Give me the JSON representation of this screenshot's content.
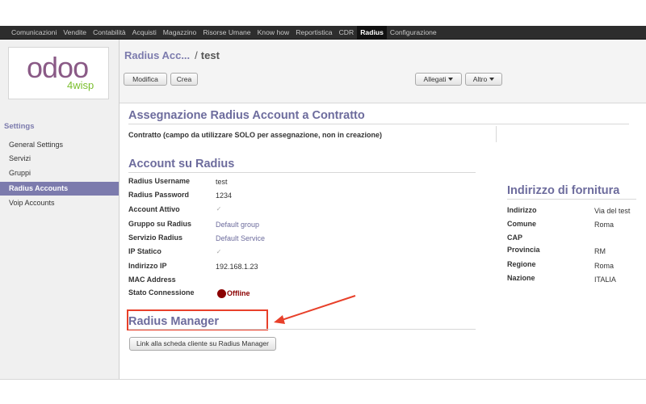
{
  "topmenu": [
    "Comunicazioni",
    "Vendite",
    "Contabilità",
    "Acquisti",
    "Magazzino",
    "Risorse Umane",
    "Know how",
    "Reportistica",
    "CDR",
    "Radius",
    "Configurazione"
  ],
  "topmenu_active": "Radius",
  "logo": {
    "brand": "odoo",
    "sub": "4wisp"
  },
  "sidebar": {
    "heading": "Settings",
    "items": [
      "General Settings",
      "Servizi",
      "Gruppi",
      "Radius Accounts",
      "Voip Accounts"
    ],
    "active": "Radius Accounts"
  },
  "header": {
    "breadcrumb_parent": "Radius Acc...",
    "breadcrumb_sep": "/",
    "breadcrumb_current": "test",
    "edit_label": "Modifica",
    "create_label": "Crea",
    "attachments_label": "Allegati",
    "more_label": "Altro"
  },
  "assignment": {
    "title": "Assegnazione Radius Account a Contratto",
    "contract_label": "Contratto (campo da utilizzare SOLO per assegnazione, non in creazione)"
  },
  "account": {
    "title": "Account su Radius",
    "username_label": "Radius Username",
    "username": "test",
    "password_label": "Radius Password",
    "password": "1234",
    "active_label": "Account Attivo",
    "active": true,
    "group_label": "Gruppo su Radius",
    "group": "Default group",
    "service_label": "Servizio Radius",
    "service": "Default Service",
    "static_ip_label": "IP Statico",
    "static_ip": true,
    "ip_label": "Indirizzo IP",
    "ip": "192.168.1.23",
    "mac_label": "MAC Address",
    "mac": "",
    "status_label": "Stato Connessione",
    "status": "Offline",
    "status_color": "#8b0000"
  },
  "supply_address": {
    "title": "Indirizzo di fornitura",
    "address_label": "Indirizzo",
    "address": "Via del test",
    "city_label": "Comune",
    "city": "Roma",
    "zip_label": "CAP",
    "zip": "",
    "province_label": "Provincia",
    "province": "RM",
    "region_label": "Regione",
    "region": "Roma",
    "country_label": "Nazione",
    "country": "ITALIA"
  },
  "radius_manager": {
    "title": "Radius Manager",
    "link_label": "Link alla scheda cliente su Radius Manager"
  },
  "annotation": {
    "highlight_color": "#e8402a",
    "arrow_color": "#e8402a"
  }
}
